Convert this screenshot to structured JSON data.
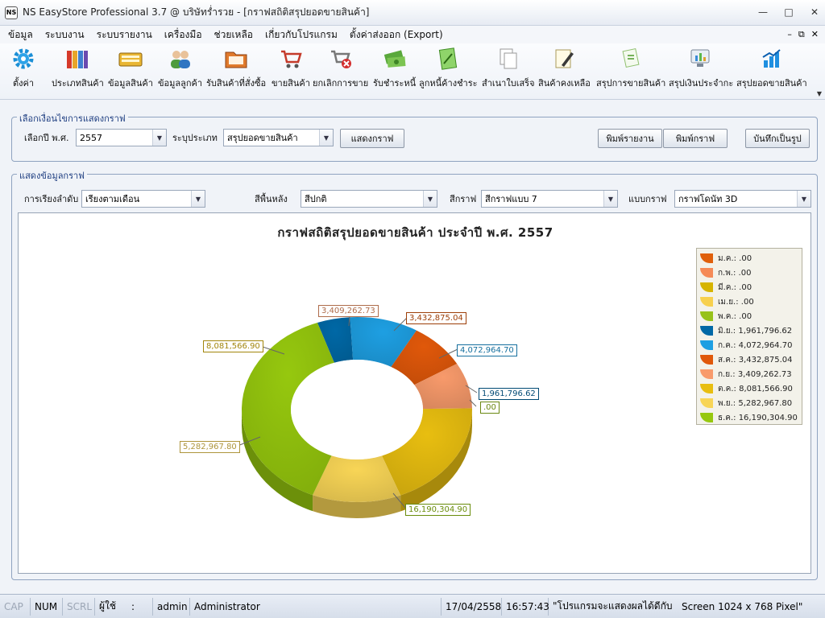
{
  "window": {
    "title": "NS EasyStore Professional 3.7 @ บริษัทร่ำรวย - [กราฟสถิติสรุปยอดขายสินค้า]",
    "icon_text": "NS"
  },
  "menu": [
    "ข้อมูล",
    "ระบบงาน",
    "ระบบรายงาน",
    "เครื่องมือ",
    "ช่วยเหลือ",
    "เกี่ยวกับโปรแกรม",
    "ตั้งค่าส่งออก (Export)"
  ],
  "toolbar": [
    {
      "label": "ตั้งค่า",
      "icon": "gear-icon"
    },
    {
      "label": "ประเภทสินค้า",
      "icon": "binders-icon"
    },
    {
      "label": "ข้อมูลสินค้า",
      "icon": "keyboard-icon"
    },
    {
      "label": "ข้อมูลลูกค้า",
      "icon": "users-icon"
    },
    {
      "label": "รับสินค้าที่สั่งซื้อ",
      "icon": "folder-icon"
    },
    {
      "label": "ขายสินค้า",
      "icon": "cart-icon"
    },
    {
      "label": "ยกเลิกการขาย",
      "icon": "cart-cancel-icon"
    },
    {
      "label": "รับชำระหนี้",
      "icon": "money-icon"
    },
    {
      "label": "ลูกหนี้ค้างชำระ",
      "icon": "notebook-icon"
    },
    {
      "label": "สำเนาใบเสร็จ",
      "icon": "copy-icon"
    },
    {
      "label": "สินค้าคงเหลือ",
      "icon": "notepad-pen-icon"
    },
    {
      "label": "สรุปการขายสินค้า",
      "icon": "receipt-icon"
    },
    {
      "label": "สรุปเงินประจำกะ",
      "icon": "monitor-chart-icon"
    },
    {
      "label": "สรุปยอดขายสินค้า",
      "icon": "bar-chart-icon"
    }
  ],
  "options_group": {
    "title": "เลือกเงื่อนไขการแสดงกราฟ",
    "year_label": "เลือกปี พ.ศ.",
    "year_value": "2557",
    "type_label": "ระบุประเภท",
    "type_value": "สรุปยอดขายสินค้า",
    "show_button": "แสดงกราฟ",
    "print_report_button": "พิมพ์รายงาน",
    "print_graph_button": "พิมพ์กราฟ",
    "save_image_button": "บันทึกเป็นรูป"
  },
  "display_group": {
    "title": "แสดงข้อมูลกราฟ",
    "sort_label": "การเรียงลำดับ",
    "sort_value": "เรียงตามเดือน",
    "bg_label": "สีพื้นหลัง",
    "bg_value": "สีปกติ",
    "color_label": "สีกราฟ",
    "color_value": "สีกราฟแบบ 7",
    "style_label": "แบบกราฟ",
    "style_value": "กราฟโดนัท 3D"
  },
  "chart_data": {
    "type": "pie",
    "title": "กราฟสถิติสรุปยอดขายสินค้า ประจำปี พ.ศ. 2557",
    "categories": [
      "ม.ค.",
      "ก.พ.",
      "มี.ค.",
      "เม.ย.",
      "พ.ค.",
      "มิ.ย.",
      "ก.ค.",
      "ส.ค.",
      "ก.ย.",
      "ต.ค.",
      "พ.ย.",
      "ธ.ค."
    ],
    "values": [
      0,
      0,
      0,
      0,
      0,
      1961796.62,
      4072964.7,
      3432875.04,
      3409262.73,
      8081566.9,
      5282967.8,
      16190304.9
    ],
    "legend_labels": [
      "ม.ค.: .00",
      "ก.พ.: .00",
      "มี.ค.: .00",
      "เม.ย.: .00",
      "พ.ค.: .00",
      "มิ.ย.: 1,961,796.62",
      "ก.ค.: 4,072,964.70",
      "ส.ค.: 3,432,875.04",
      "ก.ย.: 3,409,262.73",
      "ต.ค.: 8,081,566.90",
      "พ.ย.: 5,282,967.80",
      "ธ.ค.: 16,190,304.90"
    ],
    "data_labels": [
      ".00",
      "1,961,796.62",
      "4,072,964.70",
      "3,432,875.04",
      "3,409,262.73",
      "8,081,566.90",
      "5,282,967.80",
      "16,190,304.90"
    ],
    "colors": [
      "#e0600c",
      "#f58a57",
      "#d6b400",
      "#f7d04d",
      "#97c21a",
      "#0068a6",
      "#1e9fe2",
      "#e0580a",
      "#f89a6b",
      "#e8be10",
      "#f8d556",
      "#96c80e"
    ],
    "legend_position": "right"
  },
  "status": {
    "cap": "CAP",
    "num": "NUM",
    "scrl": "SCRL",
    "user_label": "ผู้ใช้",
    "colon": ":",
    "username": "admin",
    "role": "Administrator",
    "date": "17/04/2558",
    "time": "16:57:43",
    "message": "\"โปรแกรมจะแสดงผลได้ดีกับ",
    "screen": "Screen 1024 x 768 Pixel\""
  }
}
